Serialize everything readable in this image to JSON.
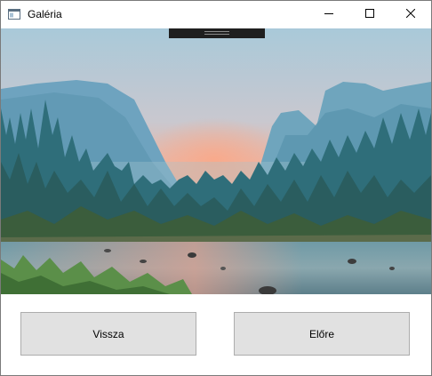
{
  "window": {
    "title": "Galéria",
    "icon": "app-window-icon",
    "controls": {
      "minimize_icon": "minimize-icon",
      "maximize_icon": "maximize-icon",
      "close_icon": "close-icon"
    }
  },
  "gallery": {
    "image_subject": "mountain-valley-river-at-sunset",
    "handle_icon": "drag-handle-icon"
  },
  "buttons": {
    "back_label": "Vissza",
    "forward_label": "Előre"
  },
  "colors": {
    "button_bg": "#e1e1e1",
    "button_border": "#adadad",
    "handle_bg": "#1f1f1f",
    "sky_top": "#9cc3d6",
    "sky_glow": "#f5a98e"
  }
}
